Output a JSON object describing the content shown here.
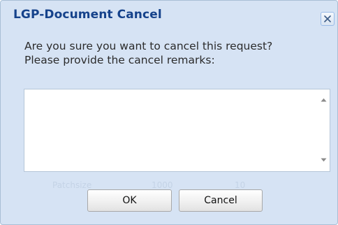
{
  "dialog": {
    "title": "LGP-Document Cancel",
    "message_line1": "Are you sure you want to cancel this request?",
    "message_line2": "Please provide the cancel remarks:",
    "remarks_value": "",
    "ok_label": "OK",
    "cancel_label": "Cancel"
  },
  "background_ghost": {
    "label": "Patchsize",
    "value1": "1000",
    "value2": "10"
  },
  "icons": {
    "close": "close-icon",
    "scroll_up": "scroll-up-arrow-icon",
    "scroll_down": "scroll-down-arrow-icon"
  },
  "colors": {
    "title": "#15428b",
    "dialog_bg": "#d6e3f4",
    "border": "#a9bfd6"
  }
}
